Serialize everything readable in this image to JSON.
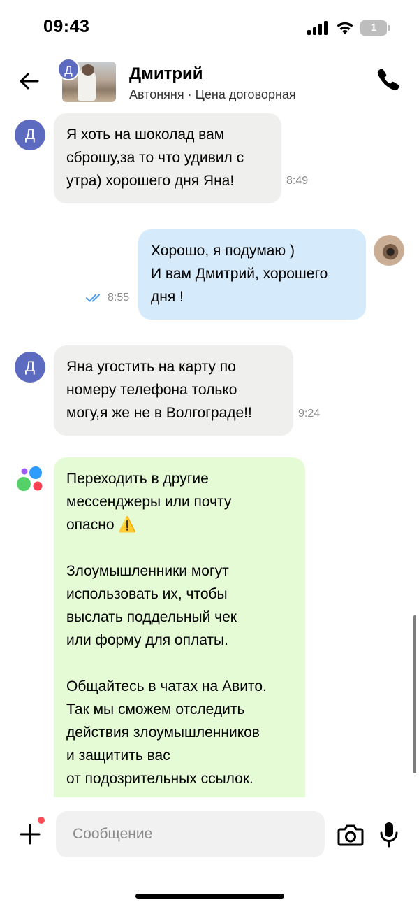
{
  "status_bar": {
    "time": "09:43",
    "battery_level": "1"
  },
  "header": {
    "contact_name": "Дмитрий",
    "contact_initial": "Д",
    "listing_subtitle": "Автоняня · Цена договорная"
  },
  "messages": [
    {
      "direction": "incoming",
      "sender_initial": "Д",
      "lines": [
        "Я хоть на шоколад вам",
        "сброшу,за то что удивил с",
        "утра) хорошего дня Яна!"
      ],
      "time": "8:49"
    },
    {
      "direction": "outgoing",
      "lines": [
        "Хорошо, я подумаю )",
        "И вам Дмитрий, хорошего",
        "дня !"
      ],
      "time": "8:55",
      "status": "read"
    },
    {
      "direction": "incoming",
      "sender_initial": "Д",
      "lines": [
        "Яна угостить на карту по",
        "номеру телефона только",
        "могу,я же не в Волгограде!!"
      ],
      "time": "9:24"
    },
    {
      "direction": "system",
      "paragraphs": [
        [
          "Переходить в другие",
          "мессенджеры или почту",
          "опасно ⚠️"
        ],
        [
          "Злоумышленники могут",
          "использовать их, чтобы",
          "выслать поддельный чек",
          "или форму для оплаты."
        ],
        [
          "Общайтесь в чатах на Авито.",
          "Так мы сможем отследить",
          "действия злоумышленников",
          "и защитить вас",
          "от подозрительных ссылок."
        ]
      ]
    }
  ],
  "composer": {
    "placeholder": "Сообщение"
  },
  "colors": {
    "incoming_bubble": "#efefed",
    "outgoing_bubble": "#d5ebfb",
    "system_bubble": "#e5fbd6",
    "avatar": "#5c6bc0",
    "read_ticks": "#4a9ee8",
    "notification_dot": "#ff4b55"
  }
}
